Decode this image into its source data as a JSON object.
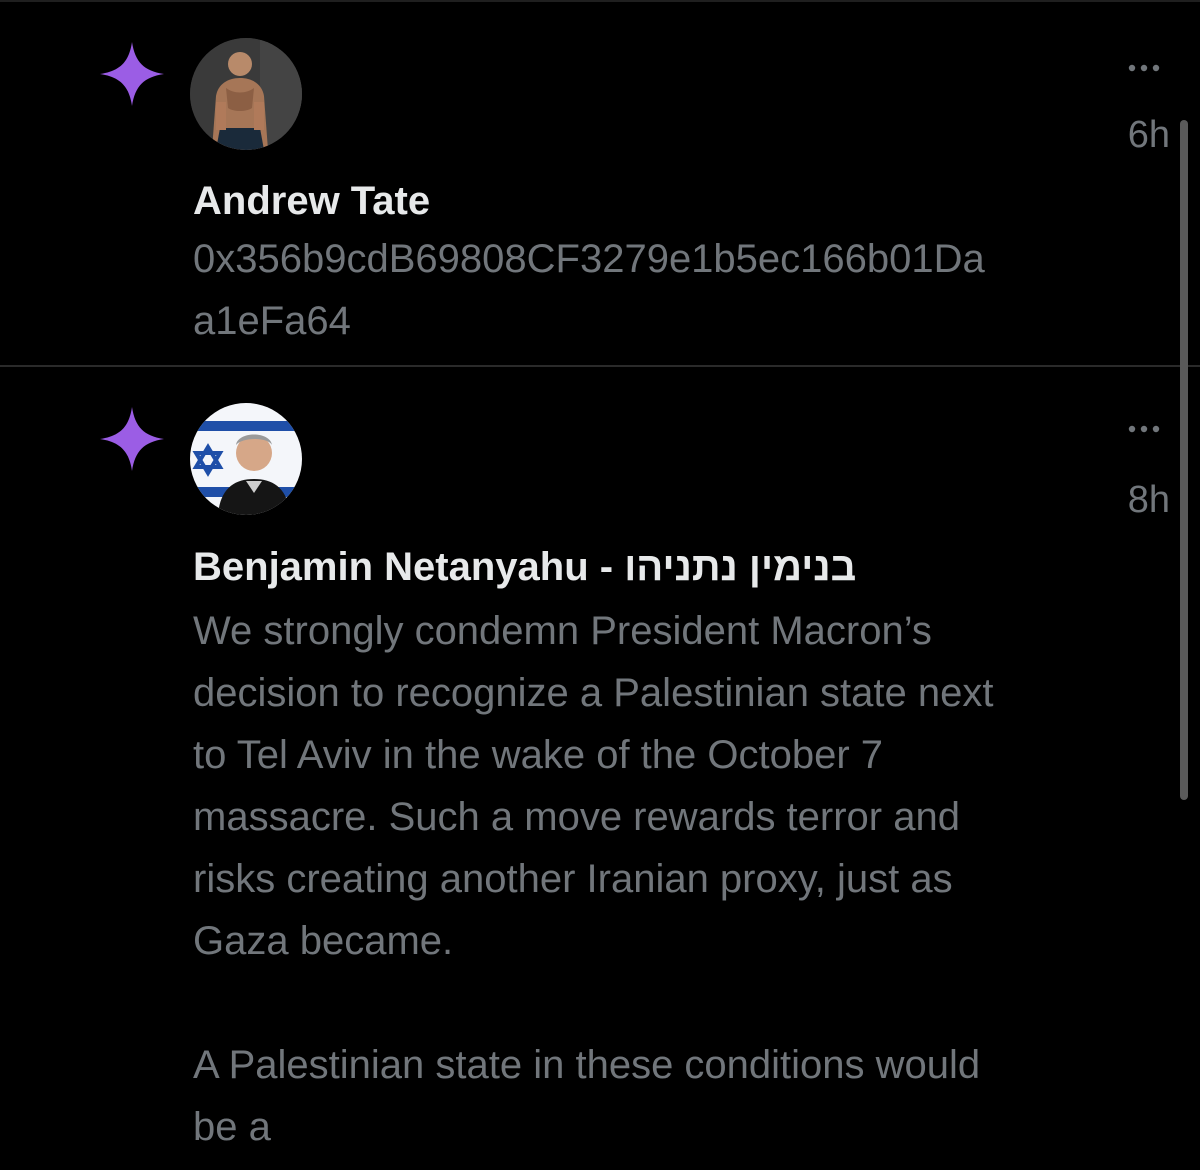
{
  "notifications": [
    {
      "author": "Andrew Tate",
      "time": "6h",
      "body": "0x356b9cdB69808CF3279e1b5ec166b01Da\na1eFa64",
      "icon": "sparkle-icon",
      "avatar": "avatar-photo"
    },
    {
      "author": "Benjamin Netanyahu - בנימין נתניהו",
      "time": "8h",
      "body": "We strongly condemn President Macron’s\ndecision to recognize a Palestinian state next\nto Tel Aviv in the wake of the October 7\nmassacre. Such a move rewards terror and\nrisks creating another Iranian proxy, just as\nGaza became.\n\nA Palestinian state in these conditions would\nbe a",
      "icon": "sparkle-icon",
      "avatar": "avatar-photo"
    }
  ],
  "colors": {
    "background": "#000000",
    "author_text": "#e7e9ea",
    "body_text": "#71767b",
    "sparkle": "#9b5de5",
    "divider": "#2a2a2a"
  }
}
